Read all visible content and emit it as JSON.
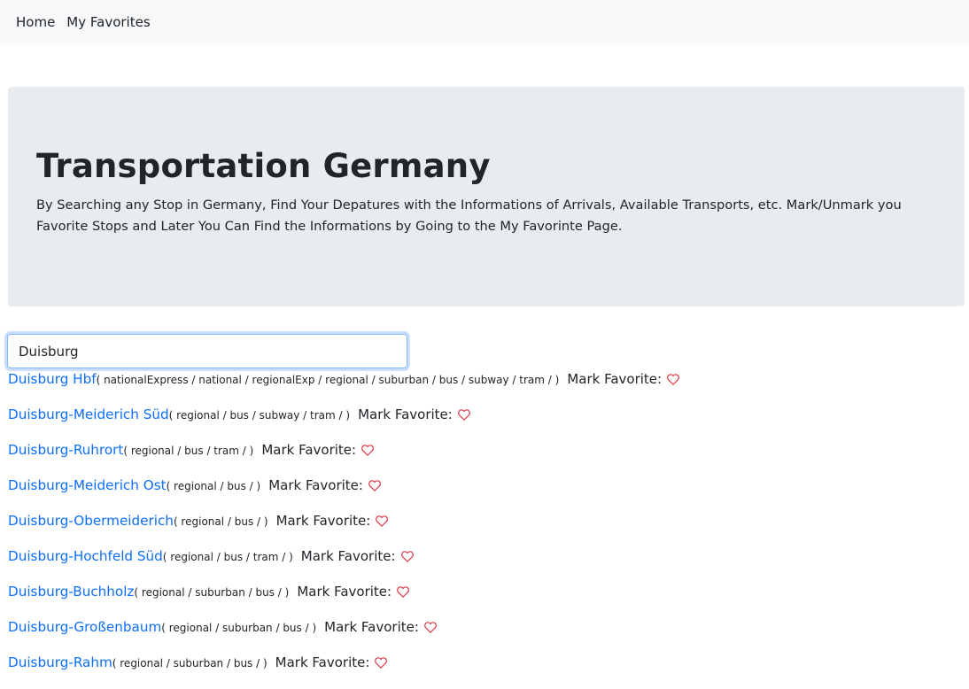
{
  "nav": {
    "items": [
      "Home",
      "My Favorites"
    ]
  },
  "hero": {
    "title": "Transportation Germany",
    "description": "By Searching any Stop in Germany, Find Your Depatures with the Informations of Arrivals, Available Transports, etc. Mark/Unmark you Favorite Stops and Later You Can Find the Informations by Going to the My Favorinte Page."
  },
  "search": {
    "value": "Duisburg"
  },
  "colors": {
    "link": "#0d6efd",
    "heart": "#dc3545"
  },
  "results": [
    {
      "name": "Duisburg Hbf",
      "modes": "( nationalExpress / national / regionalExp / regional / suburban / bus / subway / tram / )",
      "mark_label": "Mark Favorite:",
      "icon": "heart-outline-icon"
    },
    {
      "name": "Duisburg-Meiderich Süd",
      "modes": "( regional / bus / subway / tram / )",
      "mark_label": "Mark Favorite:",
      "icon": "heart-outline-icon"
    },
    {
      "name": "Duisburg-Ruhrort",
      "modes": "( regional / bus / tram / )",
      "mark_label": "Mark Favorite:",
      "icon": "heart-outline-icon"
    },
    {
      "name": "Duisburg-Meiderich Ost",
      "modes": "( regional / bus / )",
      "mark_label": "Mark Favorite:",
      "icon": "heart-outline-icon"
    },
    {
      "name": "Duisburg-Obermeiderich",
      "modes": "( regional / bus / )",
      "mark_label": "Mark Favorite:",
      "icon": "heart-outline-icon"
    },
    {
      "name": "Duisburg-Hochfeld Süd",
      "modes": "( regional / bus / tram / )",
      "mark_label": "Mark Favorite:",
      "icon": "heart-outline-icon"
    },
    {
      "name": "Duisburg-Buchholz",
      "modes": "( regional / suburban / bus / )",
      "mark_label": "Mark Favorite:",
      "icon": "heart-outline-icon"
    },
    {
      "name": "Duisburg-Großenbaum",
      "modes": "( regional / suburban / bus / )",
      "mark_label": "Mark Favorite:",
      "icon": "heart-outline-icon"
    },
    {
      "name": "Duisburg-Rahm",
      "modes": "( regional / suburban / bus / )",
      "mark_label": "Mark Favorite:",
      "icon": "heart-outline-icon"
    }
  ]
}
